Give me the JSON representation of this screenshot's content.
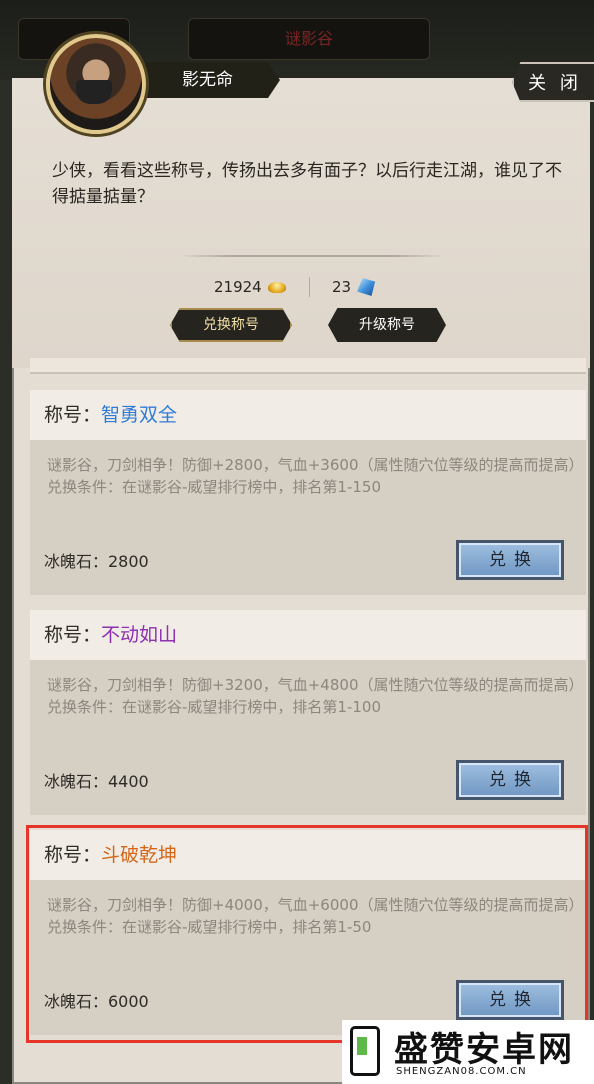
{
  "background": {
    "tabs": [
      "",
      "谜影谷"
    ]
  },
  "npc": {
    "name": "影无命"
  },
  "close_label": "关 闭",
  "dialog": "少侠，看看这些称号，传扬出去多有面子？以后行走江湖，谁见了不得掂量掂量？",
  "currency": {
    "gold": {
      "value": "21924",
      "icon": "gold-ingot-icon"
    },
    "gem": {
      "value": "23",
      "icon": "ice-crystal-icon"
    }
  },
  "buttons": {
    "exchange_title": "兑换称号",
    "upgrade_title": "升级称号"
  },
  "cards": [
    {
      "label": "称号：",
      "title": "智勇双全",
      "title_color": "#2f7bd6",
      "description": "谜影谷，刀剑相争！防御+2800，气血+3600（属性随穴位等级的提高而提高）",
      "condition": "兑换条件：在谜影谷-威望排行榜中，排名第1-150",
      "cost": "冰魄石：2800",
      "button": "兑换"
    },
    {
      "label": "称号：",
      "title": "不动如山",
      "title_color": "#8c2fb0",
      "description": "谜影谷，刀剑相争！防御+3200，气血+4800（属性随穴位等级的提高而提高）",
      "condition": "兑换条件：在谜影谷-威望排行榜中，排名第1-100",
      "cost": "冰魄石：4400",
      "button": "兑换"
    },
    {
      "label": "称号：",
      "title": "斗破乾坤",
      "title_color": "#d4661a",
      "description": "谜影谷，刀剑相争！防御+4000，气血+6000（属性随穴位等级的提高而提高）",
      "condition": "兑换条件：在谜影谷-威望排行榜中，排名第1-50",
      "cost": "冰魄石：6000",
      "button": "兑换"
    }
  ],
  "watermark": {
    "title": "盛赞安卓网",
    "sub": "SHENGZAN08.COM.CN"
  }
}
